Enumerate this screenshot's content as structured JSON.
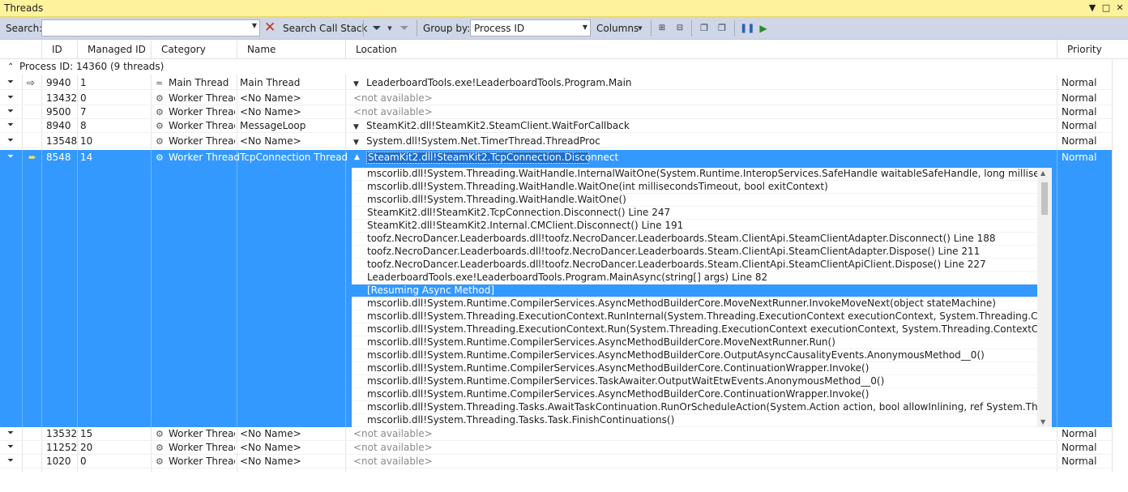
{
  "window": {
    "title": "Threads"
  },
  "toolbar": {
    "search_label": "Search:",
    "search_value": "",
    "search_call_stack_label": "Search Call Stack",
    "group_by_label": "Group by:",
    "group_by_value": "Process ID",
    "columns_label": "Columns"
  },
  "columns": [
    "ID",
    "Managed ID",
    "Category",
    "Name",
    "Location",
    "Priority"
  ],
  "group": {
    "label": "Process ID: 14360  (9 threads)"
  },
  "threads_top": [
    {
      "id": "9940",
      "managed_id": "1",
      "category": "Main Thread",
      "name": "Main Thread",
      "location": "LeaderboardTools.exe!LeaderboardTools.Program.Main",
      "priority": "Normal",
      "available": true,
      "current": true
    },
    {
      "id": "13432",
      "managed_id": "0",
      "category": "Worker Thread",
      "name": "<No Name>",
      "location": "<not available>",
      "priority": "Normal",
      "available": false
    },
    {
      "id": "9500",
      "managed_id": "7",
      "category": "Worker Thread",
      "name": "<No Name>",
      "location": "<not available>",
      "priority": "Normal",
      "available": false
    },
    {
      "id": "8940",
      "managed_id": "8",
      "category": "Worker Thread",
      "name": "MessageLoop",
      "location": "SteamKit2.dll!SteamKit2.SteamClient.WaitForCallback",
      "priority": "Normal",
      "available": true
    },
    {
      "id": "13548",
      "managed_id": "10",
      "category": "Worker Thread",
      "name": "<No Name>",
      "location": "System.dll!System.Net.TimerThread.ThreadProc",
      "priority": "Normal",
      "available": true
    }
  ],
  "selected_thread": {
    "id": "8548",
    "managed_id": "14",
    "category": "Worker Thread",
    "name": "TcpConnection Thread",
    "location": "SteamKit2.dll!SteamKit2.TcpConnection.Disconnect",
    "priority": "Normal"
  },
  "call_stack": [
    "mscorlib.dll!System.Threading.WaitHandle.InternalWaitOne(System.Runtime.InteropServices.SafeHandle waitableSafeHandle, long millisecondsTimeout, boo",
    "mscorlib.dll!System.Threading.WaitHandle.WaitOne(int millisecondsTimeout, bool exitContext)",
    "mscorlib.dll!System.Threading.WaitHandle.WaitOne()",
    "SteamKit2.dll!SteamKit2.TcpConnection.Disconnect() Line 247",
    "SteamKit2.dll!SteamKit2.Internal.CMClient.Disconnect() Line 191",
    "toofz.NecroDancer.Leaderboards.dll!toofz.NecroDancer.Leaderboards.Steam.ClientApi.SteamClientAdapter.Disconnect() Line 188",
    "toofz.NecroDancer.Leaderboards.dll!toofz.NecroDancer.Leaderboards.Steam.ClientApi.SteamClientAdapter.Dispose() Line 211",
    "toofz.NecroDancer.Leaderboards.dll!toofz.NecroDancer.Leaderboards.Steam.ClientApi.SteamClientApiClient.Dispose() Line 227",
    "LeaderboardTools.exe!LeaderboardTools.Program.MainAsync(string[] args) Line 82",
    "[Resuming Async Method]",
    "mscorlib.dll!System.Runtime.CompilerServices.AsyncMethodBuilderCore.MoveNextRunner.InvokeMoveNext(object stateMachine)",
    "mscorlib.dll!System.Threading.ExecutionContext.RunInternal(System.Threading.ExecutionContext executionContext, System.Threading.ContextCallback callba",
    "mscorlib.dll!System.Threading.ExecutionContext.Run(System.Threading.ExecutionContext executionContext, System.Threading.ContextCallback callback, obj",
    "mscorlib.dll!System.Runtime.CompilerServices.AsyncMethodBuilderCore.MoveNextRunner.Run()",
    "mscorlib.dll!System.Runtime.CompilerServices.AsyncMethodBuilderCore.OutputAsyncCausalityEvents.AnonymousMethod__0()",
    "mscorlib.dll!System.Runtime.CompilerServices.AsyncMethodBuilderCore.ContinuationWrapper.Invoke()",
    "mscorlib.dll!System.Runtime.CompilerServices.TaskAwaiter.OutputWaitEtwEvents.AnonymousMethod__0()",
    "mscorlib.dll!System.Runtime.CompilerServices.AsyncMethodBuilderCore.ContinuationWrapper.Invoke()",
    "mscorlib.dll!System.Threading.Tasks.AwaitTaskContinuation.RunOrScheduleAction(System.Action action, bool allowInlining, ref System.Threading.Tasks.Tas",
    "mscorlib.dll!System.Threading.Tasks.Task.FinishContinuations()"
  ],
  "call_stack_selected_index": 9,
  "threads_bottom": [
    {
      "id": "13532",
      "managed_id": "15",
      "category": "Worker Thread",
      "name": "<No Name>",
      "location": "<not available>",
      "priority": "Normal"
    },
    {
      "id": "11252",
      "managed_id": "20",
      "category": "Worker Thread",
      "name": "<No Name>",
      "location": "<not available>",
      "priority": "Normal"
    },
    {
      "id": "1020",
      "managed_id": "0",
      "category": "Worker Thread",
      "name": "<No Name>",
      "location": "<not available>",
      "priority": "Normal"
    }
  ],
  "colors": {
    "title_bg": "#fff29d",
    "toolbar_bg": "#cfd6e5",
    "selection": "#3399ff"
  }
}
